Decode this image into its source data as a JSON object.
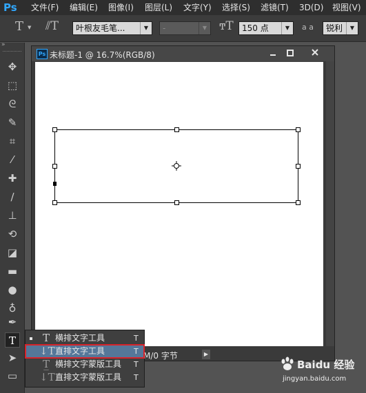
{
  "app": {
    "logo": "Ps"
  },
  "menubar": {
    "items": [
      "文件(F)",
      "编辑(E)",
      "图像(I)",
      "图层(L)",
      "文字(Y)",
      "选择(S)",
      "滤镜(T)",
      "3D(D)",
      "视图(V)"
    ]
  },
  "options": {
    "font_family": "叶根友毛笔...",
    "font_style": "-",
    "font_size": "150 点",
    "aa_label": "a a",
    "antialias": "锐利"
  },
  "document": {
    "title": "未标题-1 @ 16.7%(RGB/8)",
    "status": "M/0 字节"
  },
  "flyout": {
    "items": [
      {
        "label": "横排文字工具",
        "key": "T"
      },
      {
        "label": "直排文字工具",
        "key": "T"
      },
      {
        "label": "横排文字蒙版工具",
        "key": "T"
      },
      {
        "label": "直排文字蒙版工具",
        "key": "T"
      }
    ]
  },
  "watermark": {
    "brand": "Baidu 经验",
    "url": "jingyan.baidu.com"
  },
  "colors": {
    "highlight_border": "#d8232a",
    "selected_bg": "#557799",
    "ps_blue": "#31a8ff"
  }
}
